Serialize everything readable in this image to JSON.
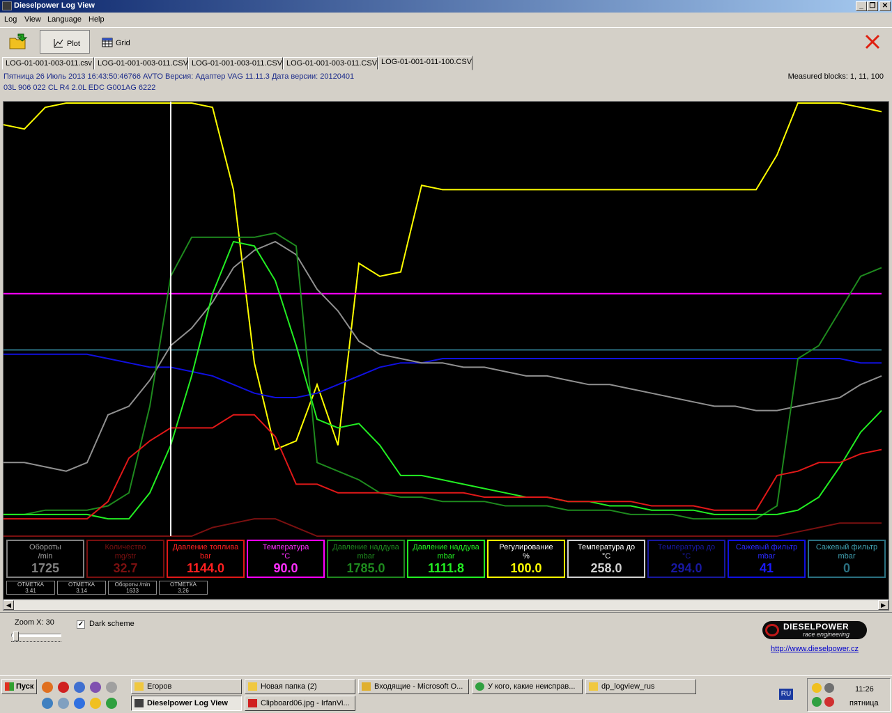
{
  "window": {
    "title": "Dieselpower Log View",
    "minimize_label": "_",
    "maximize_label": "❐",
    "close_label": "✕"
  },
  "menu": {
    "items": [
      "Log",
      "View",
      "Language",
      "Help"
    ]
  },
  "toolbar": {
    "open_icon": "folder-icon",
    "plot_label": "Plot",
    "grid_label": "Grid",
    "close_icon": "close-icon"
  },
  "tabs": [
    {
      "label": "LOG-01-001-003-011.csv",
      "active": false
    },
    {
      "label": "LOG-01-001-003-011.CSV",
      "active": false
    },
    {
      "label": "LOG-01-001-003-011.CSV",
      "active": false
    },
    {
      "label": "LOG-01-001-003-011.CSV",
      "active": false
    },
    {
      "label": "LOG-01-001-011-100.CSV",
      "active": true
    }
  ],
  "info": {
    "line1": "Пятница 26 Июль 2013 16:43:50:46766 AVTO Версия: Адаптер VAG 11.11.3 Дата версии: 20120401",
    "line2": "03L 906 022 CL   R4 2.0L EDC G001AG  6222",
    "measured_blocks": "Measured blocks: 1, 11, 100"
  },
  "chart_data": {
    "type": "line",
    "grid": false,
    "background": "#000000",
    "cursor_x": 8,
    "x": [
      0,
      1,
      2,
      3,
      4,
      5,
      6,
      7,
      8,
      9,
      10,
      11,
      12,
      13,
      14,
      15,
      16,
      17,
      18,
      19,
      20,
      21,
      22,
      23,
      24,
      25,
      26,
      27,
      28,
      29,
      30,
      31,
      32,
      33,
      34,
      35,
      36,
      37,
      38,
      39,
      40,
      41,
      42
    ],
    "series": [
      {
        "color": "#ffff00",
        "values": [
          95,
          94,
          99,
          100,
          100,
          100,
          100,
          100,
          100,
          100,
          99,
          80,
          40,
          20,
          22,
          35,
          21,
          63,
          60,
          61,
          81,
          80,
          80,
          80,
          80,
          80,
          80,
          80,
          80,
          80,
          80,
          80,
          80,
          80,
          80,
          80,
          80,
          88,
          100,
          100,
          100,
          99,
          98
        ]
      },
      {
        "color": "#ff00ff",
        "values": [
          56,
          56,
          56,
          56,
          56,
          56,
          56,
          56,
          56,
          56,
          56,
          56,
          56,
          56,
          56,
          56,
          56,
          56,
          56,
          56,
          56,
          56,
          56,
          56,
          56,
          56,
          56,
          56,
          56,
          56,
          56,
          56,
          56,
          56,
          56,
          56,
          56,
          56,
          56,
          56,
          56,
          56,
          56
        ]
      },
      {
        "color": "#2a7080",
        "values": [
          43,
          43,
          43,
          43,
          43,
          43,
          43,
          43,
          43,
          43,
          43,
          43,
          43,
          43,
          43,
          43,
          43,
          43,
          43,
          43,
          43,
          43,
          43,
          43,
          43,
          43,
          43,
          43,
          43,
          43,
          43,
          43,
          43,
          43,
          43,
          43,
          43,
          43,
          43,
          43,
          43,
          43,
          43
        ]
      },
      {
        "color": "#1010e0",
        "values": [
          42,
          42,
          42,
          42,
          42,
          41,
          40,
          39,
          39,
          38,
          37,
          35,
          33,
          32,
          32,
          33,
          35,
          37,
          39,
          40,
          40,
          41,
          41,
          41,
          41,
          41,
          41,
          41,
          41,
          41,
          41,
          41,
          41,
          41,
          41,
          41,
          41,
          41,
          41,
          41,
          41,
          40,
          40
        ]
      },
      {
        "color": "#909090",
        "values": [
          17,
          17,
          16,
          15,
          17,
          28,
          30,
          36,
          44,
          48,
          54,
          62,
          66,
          68,
          65,
          57,
          52,
          45,
          42,
          41,
          40,
          40,
          39,
          39,
          38,
          37,
          37,
          36,
          35,
          35,
          34,
          33,
          32,
          31,
          30,
          30,
          29,
          29,
          30,
          31,
          32,
          35,
          37
        ]
      },
      {
        "color": "#1e8a1e",
        "values": [
          5,
          5,
          6,
          6,
          6,
          7,
          10,
          30,
          60,
          69,
          69,
          69,
          69,
          70,
          67,
          17,
          15,
          13,
          10,
          9,
          9,
          8,
          8,
          8,
          7,
          7,
          7,
          6,
          6,
          6,
          5,
          5,
          5,
          4,
          4,
          4,
          4,
          7,
          41,
          44,
          52,
          60,
          62
        ]
      },
      {
        "color": "#22ee22",
        "values": [
          5,
          5,
          5,
          5,
          5,
          4,
          4,
          10,
          21,
          37,
          56,
          68,
          67,
          59,
          44,
          27,
          25,
          26,
          21,
          14,
          14,
          13,
          12,
          11,
          10,
          9,
          9,
          8,
          8,
          7,
          7,
          6,
          6,
          6,
          5,
          5,
          5,
          5,
          6,
          9,
          16,
          24,
          29
        ]
      },
      {
        "color": "#e01818",
        "values": [
          4,
          4,
          4,
          4,
          4,
          8,
          18,
          22,
          25,
          25,
          25,
          28,
          28,
          23,
          12,
          12,
          10,
          10,
          10,
          10,
          10,
          10,
          10,
          9,
          9,
          9,
          9,
          8,
          8,
          8,
          8,
          7,
          7,
          7,
          6,
          6,
          6,
          14,
          15,
          17,
          17,
          19,
          20
        ]
      },
      {
        "color": "#7a1010",
        "values": [
          0,
          0,
          0,
          0,
          0,
          0,
          0,
          0,
          0,
          0,
          2,
          3,
          4,
          4,
          2,
          0,
          0,
          0,
          0,
          0,
          0,
          0,
          0,
          0,
          0,
          0,
          0,
          0,
          0,
          0,
          0,
          0,
          0,
          0,
          0,
          0,
          0,
          0,
          1,
          2,
          3,
          3,
          3
        ]
      }
    ]
  },
  "gauges": [
    {
      "name": "Обороты",
      "unit": "/min",
      "value": "1725",
      "color": "#808080",
      "border": "#808080",
      "label_color": "#a0a0a0"
    },
    {
      "name": "Количество",
      "unit": "mg/str",
      "value": "32.7",
      "color": "#7a1010",
      "border": "#7a1010",
      "label_color": "#7a1010"
    },
    {
      "name": "Давление топлива",
      "unit": "bar",
      "value": "1144.0",
      "color": "#ff2020",
      "border": "#e01818",
      "label_color": "#ff2020"
    },
    {
      "name": "Температура",
      "unit": "°C",
      "value": "90.0",
      "color": "#ff30ff",
      "border": "#ff00ff",
      "label_color": "#ff30ff"
    },
    {
      "name": "Давление наддува",
      "unit": "mbar",
      "value": "1785.0",
      "color": "#1e8a1e",
      "border": "#1e8a1e",
      "label_color": "#1e8a1e"
    },
    {
      "name": "Давление наддува",
      "unit": "mbar",
      "value": "1111.8",
      "color": "#22ee22",
      "border": "#22ee22",
      "label_color": "#22ee22"
    },
    {
      "name": "Регулирование",
      "unit": "%",
      "value": "100.0",
      "color": "#ffff00",
      "border": "#ffff00",
      "label_color": "#ffffff"
    },
    {
      "name": "Температура до",
      "unit": "°C",
      "value": "258.0",
      "color": "#d0d0d0",
      "border": "#d0d0d0",
      "label_color": "#ffffff"
    },
    {
      "name": "Температура до",
      "unit": "°C",
      "value": "294.0",
      "color": "#1818a0",
      "border": "#1818a0",
      "label_color": "#1818a0"
    },
    {
      "name": "Сажевый фильтр",
      "unit": "mbar",
      "value": "41",
      "color": "#1a1aff",
      "border": "#1010e0",
      "label_color": "#2a2aff"
    },
    {
      "name": "Сажевый фильтр",
      "unit": "mbar",
      "value": "0",
      "color": "#2a7080",
      "border": "#2a7080",
      "label_color": "#40a0b0"
    }
  ],
  "marks": [
    {
      "title": "ОТМЕТКА",
      "value": "3.41"
    },
    {
      "title": "ОТМЕТКА",
      "value": "3.14"
    },
    {
      "title": "Обороты /min",
      "value": "1633"
    },
    {
      "title": "ОТМЕТКА",
      "value": "3.26"
    }
  ],
  "bottom": {
    "zoom_label": "Zoom X: 30",
    "zoom_fraction": 0.05,
    "dark_scheme_label": "Dark scheme",
    "dark_scheme_checked": true,
    "logo_main": "DIESELPOWER",
    "logo_sub": "race engineering",
    "link": "http://www.dieselpower.cz"
  },
  "taskbar": {
    "start_label": "Пуск",
    "tasks_top": [
      "Егоров",
      "Новая папка (2)",
      "Входящие - Microsoft O...",
      "У кого, какие неисправ...",
      "dp_logview_rus"
    ],
    "tasks_bottom": [
      "Dieselpower Log View",
      "Clipboard06.jpg - IrfanVi..."
    ],
    "lang": "RU",
    "time": "11:26",
    "day": "пятница"
  }
}
